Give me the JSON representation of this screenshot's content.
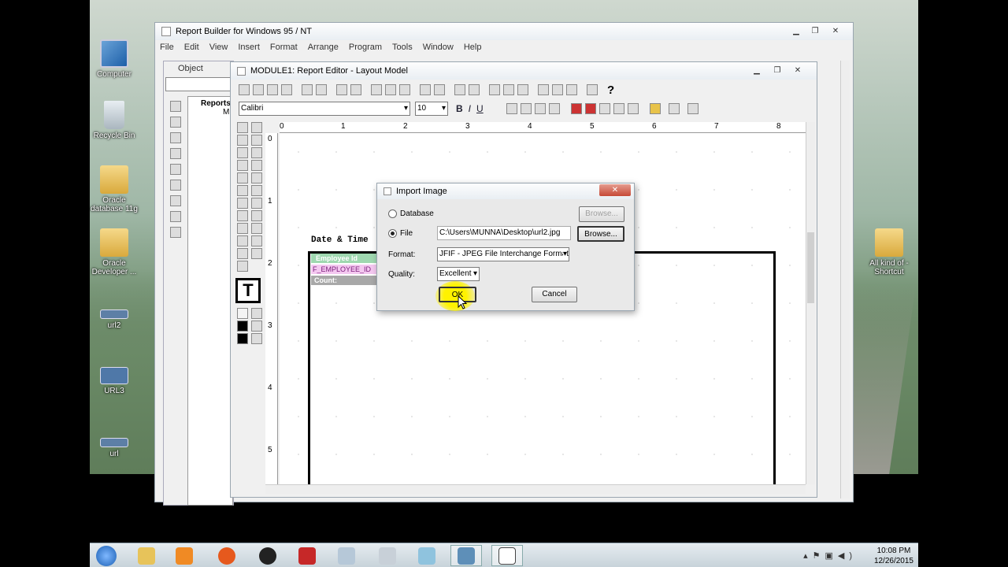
{
  "desktop": {
    "icons": [
      {
        "label": "Computer"
      },
      {
        "label": "Recycle Bin"
      },
      {
        "label": "Oracle database 11g"
      },
      {
        "label": "Oracle Developer ..."
      },
      {
        "label": "url2"
      },
      {
        "label": "URL3"
      },
      {
        "label": "url"
      },
      {
        "label": "All kind of - Shortcut"
      }
    ]
  },
  "app": {
    "title": "Report Builder for Windows 95 / NT",
    "menu": [
      "File",
      "Edit",
      "View",
      "Insert",
      "Format",
      "Arrange",
      "Program",
      "Tools",
      "Window",
      "Help"
    ]
  },
  "navigator": {
    "title": "Object Navigat",
    "root_label": "Reports",
    "child_label": "M"
  },
  "editor": {
    "title": "MODULE1: Report Editor - Layout Model",
    "font_name": "Calibri",
    "font_size": "10",
    "format_buttons": [
      "B",
      "I",
      "U"
    ],
    "ruler_numbers": [
      "0",
      "1",
      "2",
      "3",
      "4",
      "5",
      "6",
      "7",
      "8"
    ],
    "vruler_numbers": [
      "0",
      "1",
      "2",
      "3",
      "4",
      "5"
    ],
    "layout": {
      "date_time_label": "Date & Time",
      "employee_id_header": "Employee Id",
      "employee_id_field": "F_EMPLOYEE_ID",
      "count_label": "Count:"
    }
  },
  "dialog": {
    "title": "Import Image",
    "source_database_label": "Database",
    "source_file_label": "File",
    "browse_disabled_label": "Browse...",
    "browse_label": "Browse...",
    "file_path": "C:\\Users\\MUNNA\\Desktop\\url2.jpg",
    "format_label": "Format:",
    "format_value": "JFIF - JPEG File Interchange Format",
    "quality_label": "Quality:",
    "quality_value": "Excellent",
    "ok_label": "OK",
    "cancel_label": "Cancel"
  },
  "clock": {
    "time": "10:08 PM",
    "date": "12/26/2015"
  }
}
